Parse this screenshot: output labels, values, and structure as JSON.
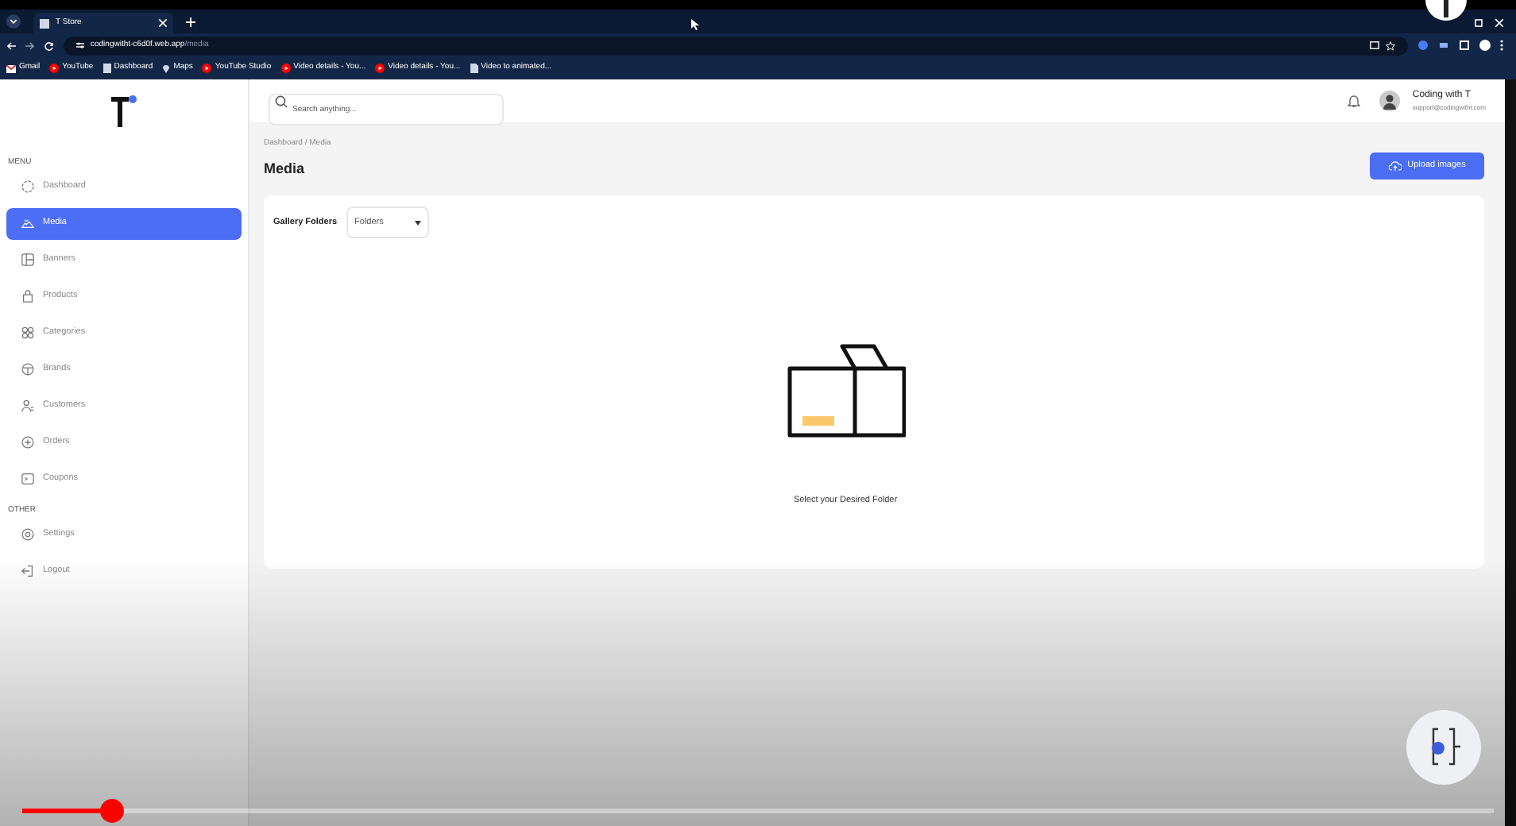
{
  "browser": {
    "tab_title": "T Store",
    "url_host": "codingwitht-c6d0f.web.app",
    "url_path": "/media",
    "bookmarks": [
      "Gmail",
      "YouTube",
      "Dashboard",
      "Maps",
      "YouTube Studio",
      "Video details - You...",
      "Video details - You...",
      "Video to animated..."
    ]
  },
  "sidebar": {
    "sections": [
      {
        "heading": "MENU",
        "items": [
          {
            "label": "Dashboard",
            "selected": false
          },
          {
            "label": "Media",
            "selected": true
          },
          {
            "label": "Banners",
            "selected": false
          },
          {
            "label": "Products",
            "selected": false
          },
          {
            "label": "Categories",
            "selected": false
          },
          {
            "label": "Brands",
            "selected": false
          },
          {
            "label": "Customers",
            "selected": false
          },
          {
            "label": "Orders",
            "selected": false
          },
          {
            "label": "Coupons",
            "selected": false
          }
        ]
      },
      {
        "heading": "OTHER",
        "items": [
          {
            "label": "Settings",
            "selected": false
          },
          {
            "label": "Logout",
            "selected": false
          }
        ]
      }
    ]
  },
  "header": {
    "search": {
      "placeholder": "Search anything..."
    },
    "user": {
      "name": "Coding with T",
      "email": "support@codingwitht.com"
    }
  },
  "page": {
    "breadcrumb": "Dashboard / Media",
    "title": "Media",
    "upload_button": "Upload images",
    "gallery_label": "Gallery Folders",
    "folder_dropdown": "Folders",
    "empty_message": "Select your Desired Folder"
  },
  "video": {
    "level": 0.06
  }
}
